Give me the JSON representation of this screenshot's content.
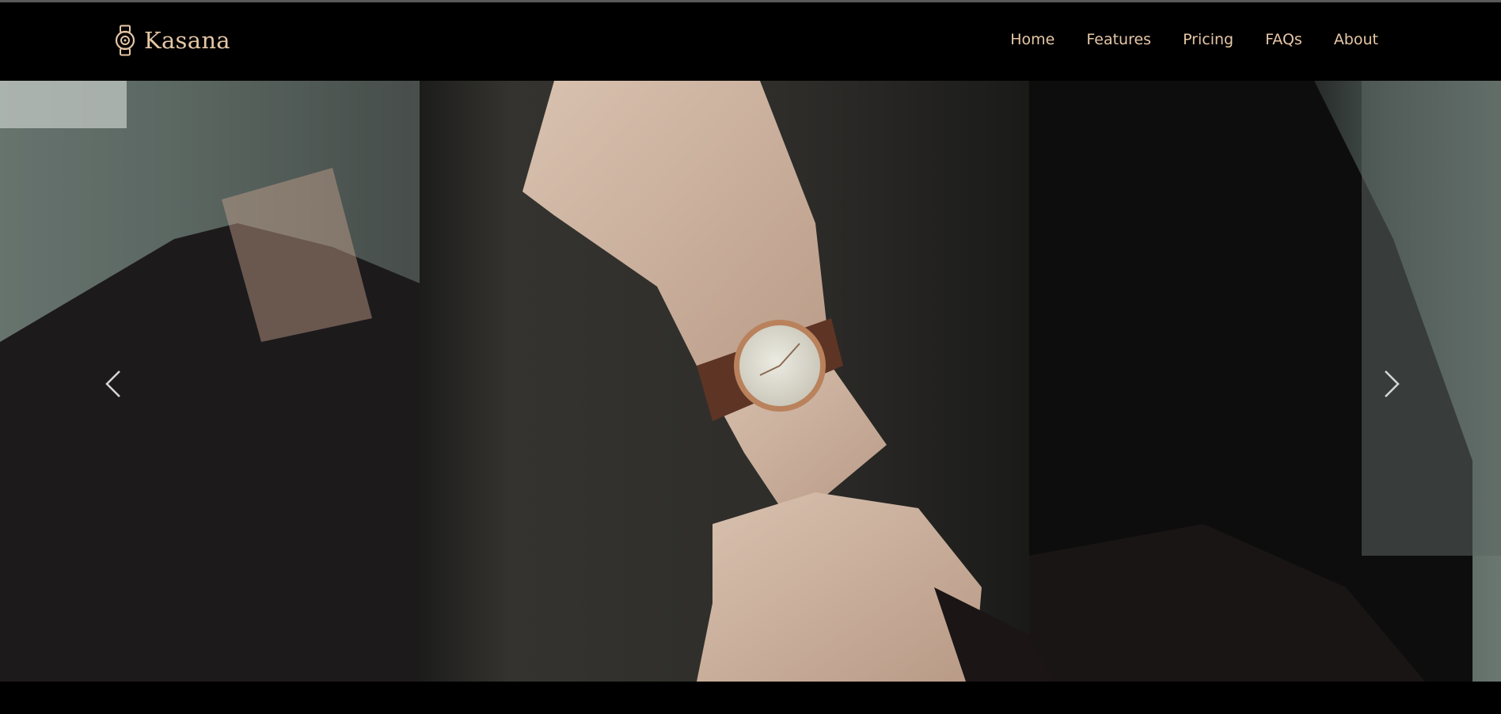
{
  "brand": {
    "name": "Kasana",
    "icon": "wristwatch-icon",
    "color": "#e6c7a5"
  },
  "nav": {
    "items": [
      {
        "label": "Home"
      },
      {
        "label": "Features"
      },
      {
        "label": "Pricing"
      },
      {
        "label": "FAQs"
      },
      {
        "label": "About"
      }
    ]
  },
  "hero": {
    "image": "person-wearing-wristwatch-photo",
    "prev_icon": "chevron-left-icon",
    "next_icon": "chevron-right-icon"
  },
  "colors": {
    "background": "#000000",
    "accent": "#e6c7a5"
  }
}
